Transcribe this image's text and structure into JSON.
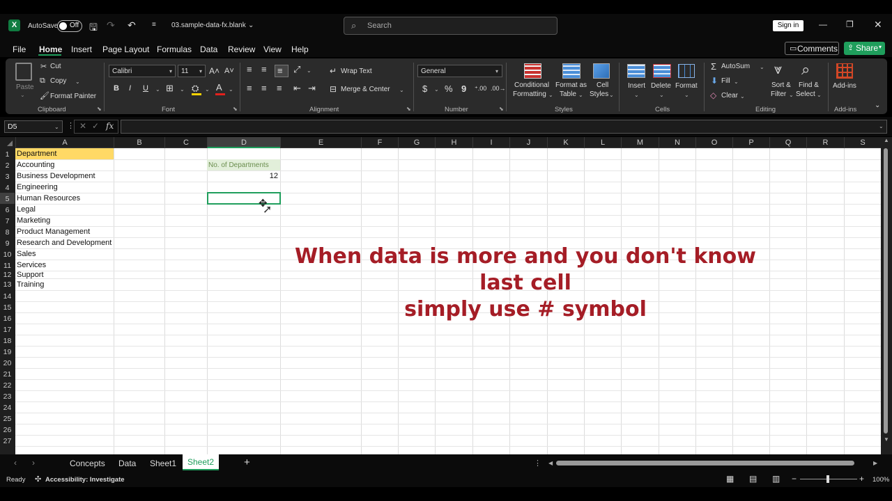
{
  "title_bar": {
    "app_icon": "excel-logo",
    "autosave_label": "AutoSave",
    "autosave_state": "Off",
    "filename": "03.sample-data-fx.blank",
    "search_placeholder": "Search",
    "signin_label": "Sign in"
  },
  "menu": {
    "items": [
      "File",
      "Home",
      "Insert",
      "Page Layout",
      "Formulas",
      "Data",
      "Review",
      "View",
      "Help"
    ],
    "active": "Home",
    "comments_label": "Comments",
    "share_label": "Share"
  },
  "ribbon": {
    "clipboard": {
      "paste": "Paste",
      "cut": "Cut",
      "copy": "Copy",
      "format_painter": "Format Painter",
      "group": "Clipboard"
    },
    "font": {
      "name": "Calibri",
      "size": "11",
      "bold": "B",
      "italic": "I",
      "underline": "U",
      "group": "Font"
    },
    "alignment": {
      "wrap": "Wrap Text",
      "merge": "Merge & Center",
      "group": "Alignment"
    },
    "number": {
      "format": "General",
      "currency": "$",
      "percent": "%",
      "comma": "9",
      "group": "Number"
    },
    "styles": {
      "conditional": "Conditional",
      "conditional2": "Formatting",
      "format_table": "Format as",
      "format_table2": "Table",
      "cell_styles": "Cell",
      "cell_styles2": "Styles",
      "group": "Styles"
    },
    "cells": {
      "insert": "Insert",
      "delete": "Delete",
      "format": "Format",
      "group": "Cells"
    },
    "editing": {
      "autosum": "AutoSum",
      "fill": "Fill",
      "clear": "Clear",
      "sort": "Sort &",
      "sort2": "Filter",
      "find": "Find &",
      "find2": "Select",
      "group": "Editing"
    },
    "addins": {
      "label": "Add-ins",
      "group": "Add-ins"
    }
  },
  "formula_bar": {
    "name_box": "D5",
    "fx": "fx",
    "value": ""
  },
  "columns": [
    "A",
    "B",
    "C",
    "D",
    "E",
    "F",
    "G",
    "H",
    "I",
    "J",
    "K",
    "L",
    "M",
    "N",
    "O",
    "P",
    "Q",
    "R",
    "S"
  ],
  "selected_column": "D",
  "rows": [
    "1",
    "2",
    "3",
    "4",
    "5",
    "6",
    "7",
    "8",
    "9",
    "10",
    "11",
    "12",
    "13",
    "14",
    "15",
    "16",
    "17",
    "18",
    "19",
    "20",
    "21",
    "22",
    "23",
    "24",
    "25",
    "26",
    "27"
  ],
  "selected_row": "5",
  "cells": {
    "A1": "Department",
    "A2": "Accounting",
    "A3": "Business Development",
    "A4": "Engineering",
    "A5": "Human Resources",
    "A6": "Legal",
    "A7": "Marketing",
    "A8": "Product Management",
    "A9": "Research and Development",
    "A10": "Sales",
    "A11": "Services",
    "A12": "Support",
    "A13": "Training",
    "D2": "No. of Departments",
    "D3": "12"
  },
  "overlay_text": {
    "line1": "When data is more and you don't know last cell",
    "line2": "simply use # symbol"
  },
  "sheet_tabs": [
    "Concepts",
    "Data",
    "Sheet1",
    "Sheet2"
  ],
  "active_sheet": "Sheet2",
  "status": {
    "ready": "Ready",
    "accessibility": "Accessibility: Investigate",
    "zoom": "100%"
  },
  "colors": {
    "accent": "#1f9e5c",
    "header_fill": "#ffd966",
    "sub_fill": "#e2efda",
    "overlay": "#a51d26"
  }
}
